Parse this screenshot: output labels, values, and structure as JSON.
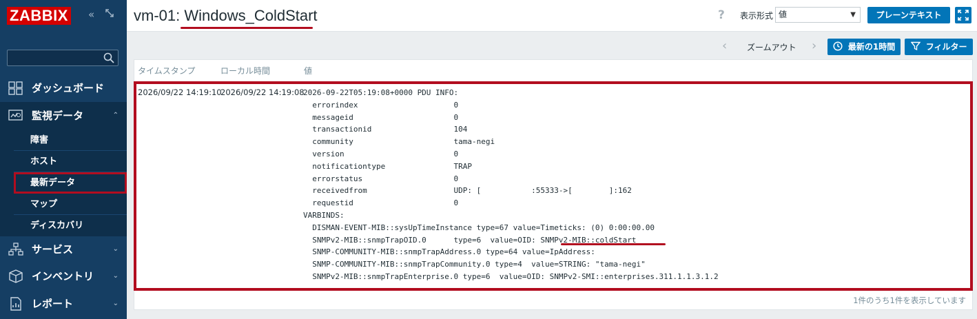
{
  "app": {
    "logo": "ZABBIX"
  },
  "sidebar": {
    "collapse_icon": "collapse-icon",
    "kiosk_icon": "kiosk-icon",
    "search": {
      "value": "",
      "placeholder": ""
    },
    "menu": [
      {
        "label": "ダッシュボード",
        "icon": "dashboard-icon"
      },
      {
        "label": "監視データ",
        "icon": "monitoring-icon",
        "expanded": true,
        "children": [
          "障害",
          "ホスト",
          "最新データ",
          "マップ",
          "ディスカバリ"
        ],
        "current": "最新データ"
      },
      {
        "label": "サービス",
        "icon": "services-icon"
      },
      {
        "label": "インベントリ",
        "icon": "inventory-icon"
      },
      {
        "label": "レポート",
        "icon": "reports-icon"
      }
    ]
  },
  "header": {
    "title": "vm-01: Windows_ColdStart",
    "help": "?",
    "format_label": "表示形式",
    "format_value": "値",
    "plain_text_button": "プレーンテキスト",
    "fullscreen_icon": "fullscreen-icon"
  },
  "filterbar": {
    "prev": "‹",
    "zoom_out": "ズームアウト",
    "next": "›",
    "last_1h": "最新の1時間",
    "filter": "フィルター"
  },
  "table": {
    "headers": [
      "タイムスタンプ",
      "ローカル時間",
      "値"
    ],
    "rows": [
      {
        "timestamp": "2026/09/22 14:19:10",
        "local_time": "2026/09/22 14:19:08",
        "value": "2026-09-22T05:19:08+0000 PDU INFO:\n  errorindex                     0\n  messageid                      0\n  transactionid                  104\n  community                      tama-negi\n  version                        0\n  notificationtype               TRAP\n  errorstatus                    0\n  receivedfrom                   UDP: [           :55333->[        ]:162\n  requestid                      0\nVARBINDS:\n  DISMAN-EVENT-MIB::sysUpTimeInstance type=67 value=Timeticks: (0) 0:00:00.00\n  SNMPv2-MIB::snmpTrapOID.0      type=6  value=OID: SNMPv2-MIB::coldStart\n  SNMP-COMMUNITY-MIB::snmpTrapAddress.0 type=64 value=IpAddress:\n  SNMP-COMMUNITY-MIB::snmpTrapCommunity.0 type=4  value=STRING: \"tama-negi\"\n  SNMPv2-MIB::snmpTrapEnterprise.0 type=6  value=OID: SNMPv2-SMI::enterprises.311.1.1.3.1.2"
      }
    ],
    "footer": "1件のうち1件を表示しています"
  },
  "colors": {
    "sidebar": "#153e63",
    "accent": "#0275b8",
    "highlight": "#b20d1f",
    "logo": "#d40000"
  }
}
